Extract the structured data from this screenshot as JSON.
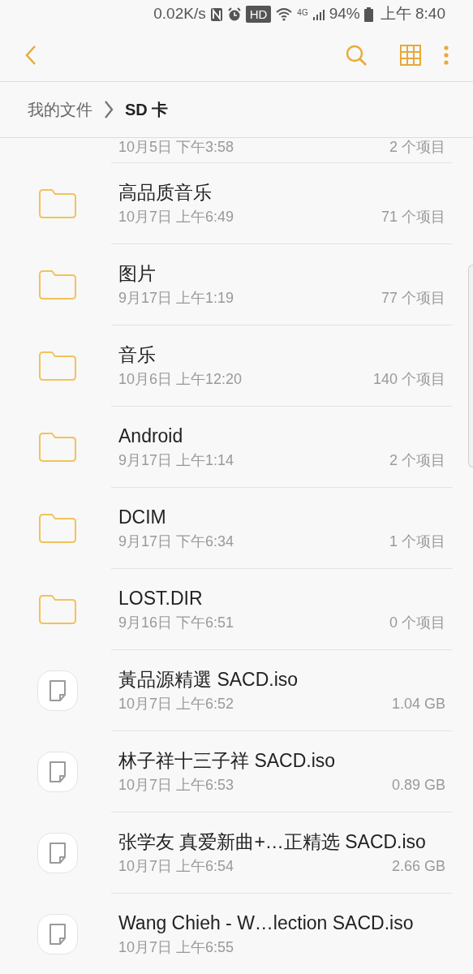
{
  "status_bar": {
    "speed": "0.02K/s",
    "hd": "HD",
    "network": "4G",
    "battery": "94%",
    "time": "上午 8:40"
  },
  "breadcrumb": [
    {
      "label": "我的文件",
      "current": false
    },
    {
      "label": "SD 卡",
      "current": true
    }
  ],
  "partial_row": {
    "date": "10月5日 下午3:58",
    "info": "2 个项目"
  },
  "rows": [
    {
      "kind": "folder",
      "name": "高品质音乐",
      "date": "10月7日 上午6:49",
      "info": "71 个项目"
    },
    {
      "kind": "folder",
      "name": "图片",
      "date": "9月17日 上午1:19",
      "info": "77 个项目"
    },
    {
      "kind": "folder",
      "name": "音乐",
      "date": "10月6日 上午12:20",
      "info": "140 个项目"
    },
    {
      "kind": "folder",
      "name": "Android",
      "date": "9月17日 上午1:14",
      "info": "2 个项目"
    },
    {
      "kind": "folder",
      "name": "DCIM",
      "date": "9月17日 下午6:34",
      "info": "1 个项目"
    },
    {
      "kind": "folder",
      "name": "LOST.DIR",
      "date": "9月16日 下午6:51",
      "info": "0 个项目"
    },
    {
      "kind": "file",
      "name": "黃品源精選 SACD.iso",
      "date": "10月7日 上午6:52",
      "info": "1.04 GB"
    },
    {
      "kind": "file",
      "name": "林子祥十三子祥 SACD.iso",
      "date": "10月7日 上午6:53",
      "info": "0.89 GB"
    },
    {
      "kind": "file",
      "name": "张学友 真爱新曲+…正精选 SACD.iso",
      "date": "10月7日 上午6:54",
      "info": "2.66 GB"
    },
    {
      "kind": "file",
      "name": "Wang Chieh - W…lection SACD.iso",
      "date": "10月7日 上午6:55"
    }
  ]
}
